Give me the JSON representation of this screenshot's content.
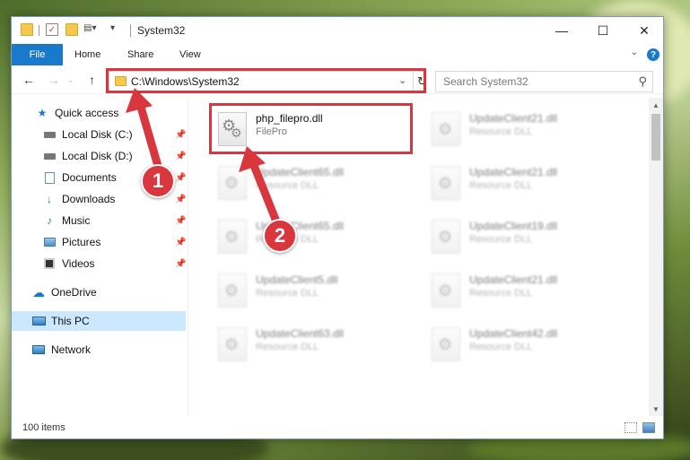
{
  "window": {
    "title": "System32",
    "minimize": "—",
    "maximize": "☐",
    "close": "✕"
  },
  "ribbon": {
    "file": "File",
    "home": "Home",
    "share": "Share",
    "view": "View",
    "help": "?",
    "collapse": "⌄"
  },
  "address": {
    "path": "C:\\Windows\\System32",
    "search_placeholder": "Search System32"
  },
  "sidebar": {
    "items": [
      {
        "label": "Quick access",
        "icon": "star-icon",
        "pinned": false
      },
      {
        "label": "Local Disk (C:)",
        "icon": "drive-icon",
        "pinned": true
      },
      {
        "label": "Local Disk (D:)",
        "icon": "drive-icon",
        "pinned": true
      },
      {
        "label": "Documents",
        "icon": "documents-icon",
        "pinned": true
      },
      {
        "label": "Downloads",
        "icon": "download-icon",
        "pinned": true
      },
      {
        "label": "Music",
        "icon": "music-icon",
        "pinned": true
      },
      {
        "label": "Pictures",
        "icon": "pictures-icon",
        "pinned": true
      },
      {
        "label": "Videos",
        "icon": "videos-icon",
        "pinned": true
      },
      {
        "label": "OneDrive",
        "icon": "cloud-icon",
        "pinned": false
      },
      {
        "label": "This PC",
        "icon": "computer-icon",
        "pinned": false,
        "selected": true
      },
      {
        "label": "Network",
        "icon": "network-icon",
        "pinned": false
      }
    ]
  },
  "files": [
    {
      "name": "php_filepro.dll",
      "type": "FilePro",
      "highlighted": true
    },
    {
      "name": "UpdateClient21.dll",
      "type": "Resource DLL"
    },
    {
      "name": "UpdateClient65.dll",
      "type": "Resource DLL"
    },
    {
      "name": "UpdateClient21.dll",
      "type": "Resource DLL"
    },
    {
      "name": "UpdateClient65.dll",
      "type": "Resource DLL"
    },
    {
      "name": "UpdateClient19.dll",
      "type": "Resource DLL"
    },
    {
      "name": "UpdateClient5.dll",
      "type": "Resource DLL"
    },
    {
      "name": "UpdateClient21.dll",
      "type": "Resource DLL"
    },
    {
      "name": "UpdateClient63.dll",
      "type": "Resource DLL"
    },
    {
      "name": "UpdateClient42.dll",
      "type": "Resource DLL"
    }
  ],
  "status": {
    "item_count": "100 items"
  },
  "callouts": {
    "one": "1",
    "two": "2"
  },
  "colors": {
    "accent": "#1979ca",
    "highlight": "#d9363e",
    "selected": "#cce8ff"
  }
}
